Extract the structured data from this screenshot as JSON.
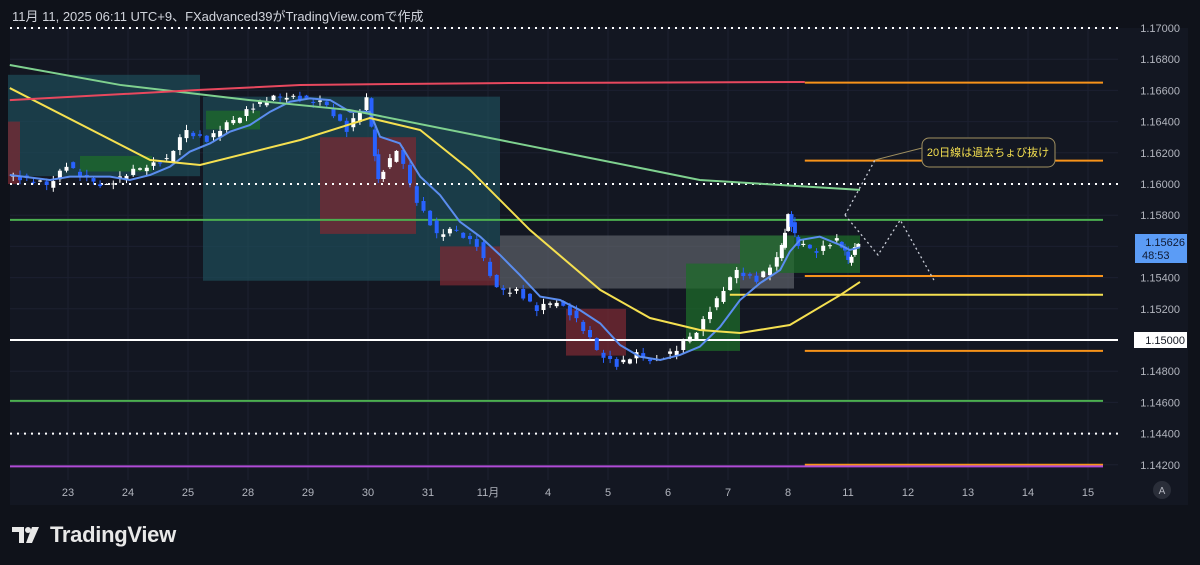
{
  "header": {
    "caption": "11月 11, 2025 06:11 UTC+9、FXadvanced39がTradingView.comで作成"
  },
  "footer": {
    "brand": "TradingView"
  },
  "colors": {
    "background": "#131722",
    "up": "#ffffff",
    "down": "#2962ff",
    "ma20": "#5b8def",
    "ma50": "#f5e050",
    "ma200": "#7fd18f",
    "ma_long": "#e8485e",
    "orange": "#f7931a",
    "green": "#4caf50",
    "purple": "#b04bd6",
    "price_label": "#5b9cf6"
  },
  "chart_data": {
    "type": "candlestick",
    "title": "EUR/USD-like 1H chart",
    "x_axis": {
      "unit": "trading days from Oct 23",
      "tick_labels": [
        "23",
        "24",
        "25",
        "28",
        "29",
        "30",
        "31",
        "11月",
        "4",
        "5",
        "6",
        "7",
        "8",
        "11",
        "12",
        "13",
        "14",
        "15"
      ]
    },
    "y_axis": {
      "range": [
        1.1412,
        1.1702
      ],
      "tick_labels": [
        "1.17000",
        "1.16800",
        "1.16600",
        "1.16400",
        "1.16200",
        "1.16000",
        "1.15800",
        "1.15400",
        "1.15200",
        "1.14800",
        "1.14600",
        "1.14400",
        "1.14200"
      ]
    },
    "last_price": {
      "value": "1.15626",
      "countdown": "48:53"
    },
    "level_label": {
      "value": "1.15000"
    },
    "price_path": [
      [
        -0.97,
        1.16058
      ],
      [
        -0.63,
        1.16026
      ],
      [
        -0.3,
        1.15994
      ],
      [
        0.03,
        1.16122
      ],
      [
        0.37,
        1.16026
      ],
      [
        0.7,
        1.15994
      ],
      [
        1.03,
        1.16058
      ],
      [
        1.37,
        1.16122
      ],
      [
        1.7,
        1.16154
      ],
      [
        2.03,
        1.16346
      ],
      [
        2.37,
        1.16282
      ],
      [
        2.7,
        1.16378
      ],
      [
        3.03,
        1.16474
      ],
      [
        3.37,
        1.16538
      ],
      [
        3.7,
        1.1657
      ],
      [
        4.03,
        1.16538
      ],
      [
        4.37,
        1.16506
      ],
      [
        4.7,
        1.16346
      ],
      [
        5.03,
        1.16538
      ],
      [
        5.2,
        1.16026
      ],
      [
        5.53,
        1.16218
      ],
      [
        5.87,
        1.15897
      ],
      [
        6.2,
        1.15673
      ],
      [
        6.53,
        1.15705
      ],
      [
        6.87,
        1.15609
      ],
      [
        7.2,
        1.15321
      ],
      [
        7.53,
        1.15321
      ],
      [
        7.87,
        1.15192
      ],
      [
        8.2,
        1.15256
      ],
      [
        8.53,
        1.15128
      ],
      [
        8.87,
        1.14936
      ],
      [
        9.2,
        1.1484
      ],
      [
        9.53,
        1.14904
      ],
      [
        9.87,
        1.14872
      ],
      [
        10.2,
        1.14936
      ],
      [
        10.53,
        1.15064
      ],
      [
        10.87,
        1.15256
      ],
      [
        11.2,
        1.15449
      ],
      [
        11.53,
        1.15385
      ],
      [
        11.87,
        1.15513
      ],
      [
        12.03,
        1.15801
      ],
      [
        12.2,
        1.15609
      ],
      [
        12.53,
        1.15577
      ],
      [
        12.87,
        1.15641
      ],
      [
        13.03,
        1.15513
      ],
      [
        13.2,
        1.15628
      ]
    ],
    "moving_averages": [
      {
        "name": "MA20",
        "color_key": "ma20",
        "computed_from": "price_path"
      },
      {
        "name": "MA50",
        "color_key": "ma50",
        "values": [
          [
            -0.97,
            1.16615
          ],
          [
            1.37,
            1.16154
          ],
          [
            2.2,
            1.16122
          ],
          [
            3.87,
            1.16282
          ],
          [
            5.03,
            1.16423
          ],
          [
            5.87,
            1.16346
          ],
          [
            6.7,
            1.1609
          ],
          [
            7.7,
            1.15705
          ],
          [
            8.87,
            1.15321
          ],
          [
            9.7,
            1.15141
          ],
          [
            10.53,
            1.15064
          ],
          [
            11.2,
            1.15045
          ],
          [
            12.03,
            1.15096
          ],
          [
            12.87,
            1.15288
          ],
          [
            13.2,
            1.15372
          ]
        ]
      },
      {
        "name": "MA200",
        "color_key": "ma200",
        "values": [
          [
            -0.97,
            1.16763
          ],
          [
            0.87,
            1.16635
          ],
          [
            3.03,
            1.16538
          ],
          [
            4.7,
            1.16474
          ],
          [
            7.2,
            1.16282
          ],
          [
            8.87,
            1.16154
          ],
          [
            10.53,
            1.16026
          ],
          [
            13.2,
            1.15962
          ]
        ]
      },
      {
        "name": "MA_long",
        "color_key": "ma_long",
        "values": [
          [
            -0.97,
            1.16538
          ],
          [
            2.2,
            1.16603
          ],
          [
            3.87,
            1.16635
          ],
          [
            7.2,
            1.16647
          ],
          [
            12.28,
            1.16654
          ]
        ]
      }
    ],
    "horizontal_levels": [
      {
        "price": 1.17,
        "style": "dotted",
        "color": "#ffffff",
        "from": -1,
        "to": 17.5
      },
      {
        "price": 1.1665,
        "style": "solid",
        "color": "#f7931a",
        "from": 12.28,
        "to": 17.25
      },
      {
        "price": 1.1615,
        "style": "solid",
        "color": "#f7931a",
        "from": 12.28,
        "to": 17.25
      },
      {
        "price": 1.16,
        "style": "dotted",
        "color": "#ffffff",
        "from": -1,
        "to": 17.5
      },
      {
        "price": 1.1577,
        "style": "solid",
        "color": "#4caf50",
        "from": -1,
        "to": 17.25
      },
      {
        "price": 1.1541,
        "style": "solid",
        "color": "#f7931a",
        "from": 12.28,
        "to": 17.25
      },
      {
        "price": 1.1529,
        "style": "solid",
        "color": "#f5e050",
        "from": 11.03,
        "to": 17.25
      },
      {
        "price": 1.15,
        "style": "solid",
        "color": "#ffffff",
        "from": -1,
        "to": 17.5
      },
      {
        "price": 1.1493,
        "style": "solid",
        "color": "#f7931a",
        "from": 12.28,
        "to": 17.25
      },
      {
        "price": 1.1461,
        "style": "solid",
        "color": "#4caf50",
        "from": -1,
        "to": 17.25
      },
      {
        "price": 1.144,
        "style": "dotted",
        "color": "#ffffff",
        "from": -1,
        "to": 17.5
      },
      {
        "price": 1.142,
        "style": "solid",
        "color": "#f7931a",
        "from": 12.28,
        "to": 17.25
      },
      {
        "price": 1.1419,
        "style": "solid",
        "color": "#b04bd6",
        "from": -1,
        "to": 17.25
      }
    ],
    "zones": [
      {
        "from": -1,
        "to": 2.2,
        "top": 1.167,
        "bottom": 1.1605,
        "color": "#1e4a55"
      },
      {
        "from": 2.25,
        "to": 7.2,
        "top": 1.1656,
        "bottom": 1.1538,
        "color": "#1e4a55"
      },
      {
        "from": -1,
        "to": -0.8,
        "top": 1.164,
        "bottom": 1.16,
        "color": "#7a2a33"
      },
      {
        "from": 4.2,
        "to": 5.8,
        "top": 1.163,
        "bottom": 1.1568,
        "color": "#7a2a33"
      },
      {
        "from": 6.2,
        "to": 7.2,
        "top": 1.156,
        "bottom": 1.1535,
        "color": "#7a2a33"
      },
      {
        "from": 8.3,
        "to": 9.3,
        "top": 1.152,
        "bottom": 1.149,
        "color": "#7a2a33"
      },
      {
        "from": 7.2,
        "to": 12.1,
        "top": 1.1567,
        "bottom": 1.1533,
        "color": "#5a5d66"
      },
      {
        "from": 10.3,
        "to": 11.2,
        "top": 1.1549,
        "bottom": 1.1493,
        "color": "#1e6b2a"
      },
      {
        "from": 11.2,
        "to": 13.2,
        "top": 1.1567,
        "bottom": 1.1543,
        "color": "#1e6b2a"
      },
      {
        "from": 0.2,
        "to": 1.4,
        "top": 1.1618,
        "bottom": 1.1608,
        "color": "#1e6b2a"
      },
      {
        "from": 2.3,
        "to": 3.2,
        "top": 1.1647,
        "bottom": 1.1635,
        "color": "#1e6b2a"
      }
    ],
    "projection_paths": [
      [
        [
          12.95,
          1.15801
        ],
        [
          13.45,
          1.16154
        ]
      ],
      [
        [
          12.95,
          1.15801
        ],
        [
          13.5,
          1.15545
        ],
        [
          13.87,
          1.15769
        ],
        [
          14.45,
          1.15372
        ]
      ]
    ],
    "annotation": {
      "text": "20日線は過去ちょび抜け",
      "anchor": [
        13.45,
        1.16154
      ]
    }
  }
}
